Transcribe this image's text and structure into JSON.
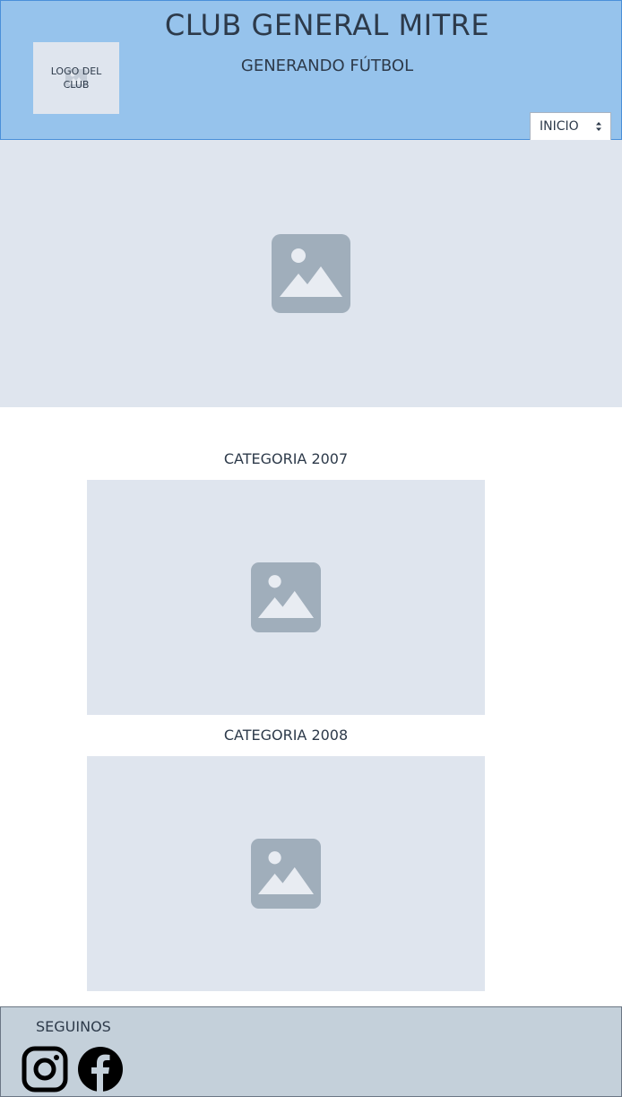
{
  "header": {
    "title": "CLUB GENERAL MITRE",
    "subtitle": "GENERANDO FÚTBOL",
    "logo_text": "LOGO DEL CLUB",
    "nav_select_value": "INICIO"
  },
  "categories": [
    {
      "title": "CATEGORIA 2007"
    },
    {
      "title": "CATEGORIA 2008"
    }
  ],
  "footer": {
    "title": "SEGUINOS",
    "social": [
      "instagram-icon",
      "facebook-icon"
    ]
  },
  "colors": {
    "header_bg": "#96c3ec",
    "placeholder_bg": "#dfe5ee",
    "placeholder_icon": "#a0aebb",
    "footer_bg": "#c4d0da",
    "text": "#2d3a4a"
  }
}
